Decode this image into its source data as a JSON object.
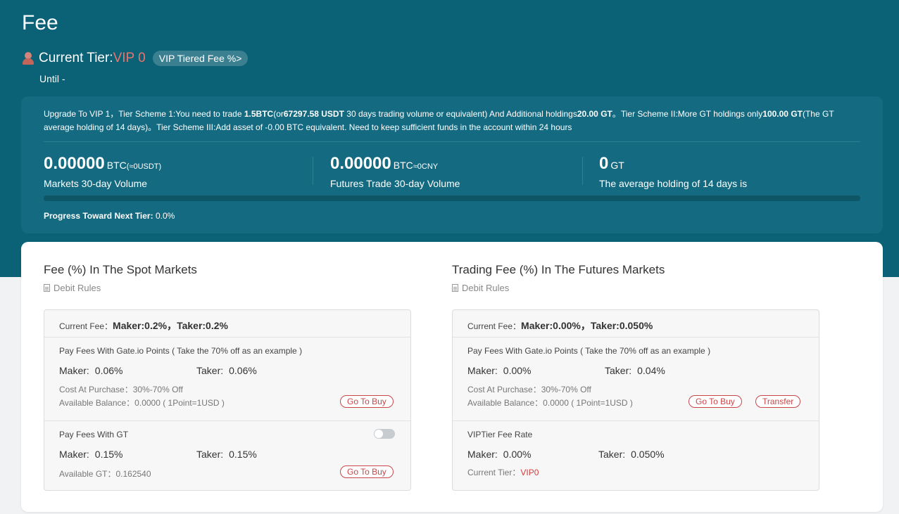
{
  "page": {
    "title": "Fee"
  },
  "tier": {
    "label": "Current Tier:",
    "value": "VIP 0",
    "tiered_fee_button": "VIP Tiered Fee %>",
    "until": "Until -"
  },
  "upgrade": {
    "p1": "Upgrade To VIP 1，Tier Scheme 1:You need to trade ",
    "b1": "1.5BTC",
    "p2": "(or",
    "b2": "67297.58 USDT",
    "p3": " 30 days trading volume or equivalent) And Additional holdings",
    "b3": "20.00 GT",
    "p4": "。Tier Scheme II:More GT holdings only",
    "b4": "100.00 GT",
    "p5": "(The GT average holding of 14 days)。Tier Scheme III:Add asset of -0.00 BTC equivalent. Need to keep sufficient funds in the account within 24 hours"
  },
  "stats": {
    "markets": {
      "value": "0.00000",
      "unit": "BTC",
      "unit_small": "(≈0USDT)",
      "caption": "Markets 30-day Volume"
    },
    "futures": {
      "value": "0.00000",
      "unit": "BTC",
      "unit_small": "≈0CNY",
      "caption": "Futures Trade 30-day Volume"
    },
    "gt": {
      "value": "0",
      "unit": "GT",
      "caption": "The average holding of 14 days is"
    }
  },
  "progress": {
    "label": "Progress Toward Next Tier:",
    "value_text": "0.0%",
    "fraction": 0.0
  },
  "spot": {
    "title": "Fee (%) In The Spot Markets",
    "debit_rules": "Debit Rules",
    "current_fee_label": "Current Fee：",
    "current_fee_value": "Maker:0.2%，Taker:0.2%",
    "points": {
      "title": "Pay Fees With Gate.io Points ( Take the 70% off as an example )",
      "maker_label": "Maker:",
      "maker_value": "0.06%",
      "taker_label": "Taker:",
      "taker_value": "0.06%",
      "cost": "Cost At Purchase：30%-70% Off",
      "balance": "Available Balance：0.0000 ( 1Point=1USD )",
      "buy_button": "Go To Buy"
    },
    "gt": {
      "title": "Pay Fees With GT",
      "toggle_on": false,
      "maker_label": "Maker:",
      "maker_value": "0.15%",
      "taker_label": "Taker:",
      "taker_value": "0.15%",
      "available": "Available GT：0.162540",
      "buy_button": "Go To Buy"
    }
  },
  "futures": {
    "title": "Trading Fee (%) In The Futures Markets",
    "debit_rules": "Debit Rules",
    "current_fee_label": "Current Fee：",
    "current_fee_value": "Maker:0.00%，Taker:0.050%",
    "points": {
      "title": "Pay Fees With Gate.io Points ( Take the 70% off as an example )",
      "maker_label": "Maker:",
      "maker_value": "0.00%",
      "taker_label": "Taker:",
      "taker_value": "0.04%",
      "cost": "Cost At Purchase：30%-70% Off",
      "balance": "Available Balance：0.0000 ( 1Point=1USD )",
      "buy_button": "Go To Buy",
      "transfer_button": "Transfer"
    },
    "vip": {
      "title": "VIPTier Fee Rate",
      "maker_label": "Maker:",
      "maker_value": "0.00%",
      "taker_label": "Taker:",
      "taker_value": "0.050%",
      "tier_label": "Current Tier：",
      "tier_value": "VIP0"
    }
  },
  "colors": {
    "header_bg": "#0b6176",
    "card_bg": "#146a80",
    "accent_red": "#c9474a",
    "vip_text": "#e8756b"
  }
}
